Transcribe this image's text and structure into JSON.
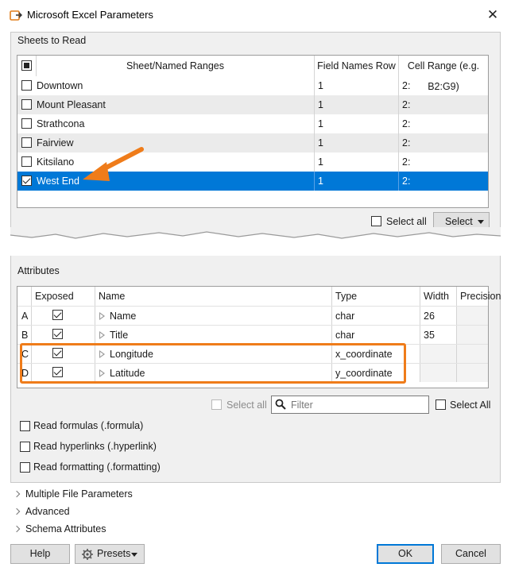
{
  "window": {
    "title": "Microsoft Excel Parameters",
    "close_glyph": "✕"
  },
  "sheets": {
    "group_label": "Sheets to Read",
    "headers": {
      "name": "Sheet/Named Ranges",
      "field_row": "Field Names Row",
      "range": "Cell Range (e.g. B2:G9)"
    },
    "rows": [
      {
        "name": "Downtown",
        "field_row": "1",
        "range": "2:",
        "checked": false,
        "selected": false
      },
      {
        "name": "Mount Pleasant",
        "field_row": "1",
        "range": "2:",
        "checked": false,
        "selected": false
      },
      {
        "name": "Strathcona",
        "field_row": "1",
        "range": "2:",
        "checked": false,
        "selected": false
      },
      {
        "name": "Fairview",
        "field_row": "1",
        "range": "2:",
        "checked": false,
        "selected": false
      },
      {
        "name": "Kitsilano",
        "field_row": "1",
        "range": "2:",
        "checked": false,
        "selected": false
      },
      {
        "name": "West End",
        "field_row": "1",
        "range": "2:",
        "checked": true,
        "selected": true
      }
    ],
    "select_all_label": "Select all",
    "select_button_label": "Select"
  },
  "attributes": {
    "group_label": "Attributes",
    "headers": {
      "exposed": "Exposed",
      "name": "Name",
      "type": "Type",
      "width": "Width",
      "precision": "Precision"
    },
    "rows": [
      {
        "id": "A",
        "name": "Name",
        "type": "char",
        "width": "26",
        "precision": "",
        "exposed": true
      },
      {
        "id": "B",
        "name": "Title",
        "type": "char",
        "width": "35",
        "precision": "",
        "exposed": true
      },
      {
        "id": "C",
        "name": "Longitude",
        "type": "x_coordinate",
        "width": "",
        "precision": "",
        "exposed": true
      },
      {
        "id": "D",
        "name": "Latitude",
        "type": "y_coordinate",
        "width": "",
        "precision": "",
        "exposed": true
      }
    ],
    "select_all_label": "Select all",
    "filter_placeholder": "Filter",
    "select_all_right_label": "Select All"
  },
  "options": [
    {
      "label": "Read formulas (.formula)",
      "checked": false
    },
    {
      "label": "Read hyperlinks (.hyperlink)",
      "checked": false
    },
    {
      "label": "Read formatting (.formatting)",
      "checked": false
    }
  ],
  "sections": [
    {
      "label": "Multiple File Parameters"
    },
    {
      "label": "Advanced"
    },
    {
      "label": "Schema Attributes"
    }
  ],
  "footer": {
    "help": "Help",
    "presets": "Presets",
    "ok": "OK",
    "cancel": "Cancel"
  },
  "colors": {
    "selection": "#0078d7",
    "highlight": "#ef7c1a"
  }
}
